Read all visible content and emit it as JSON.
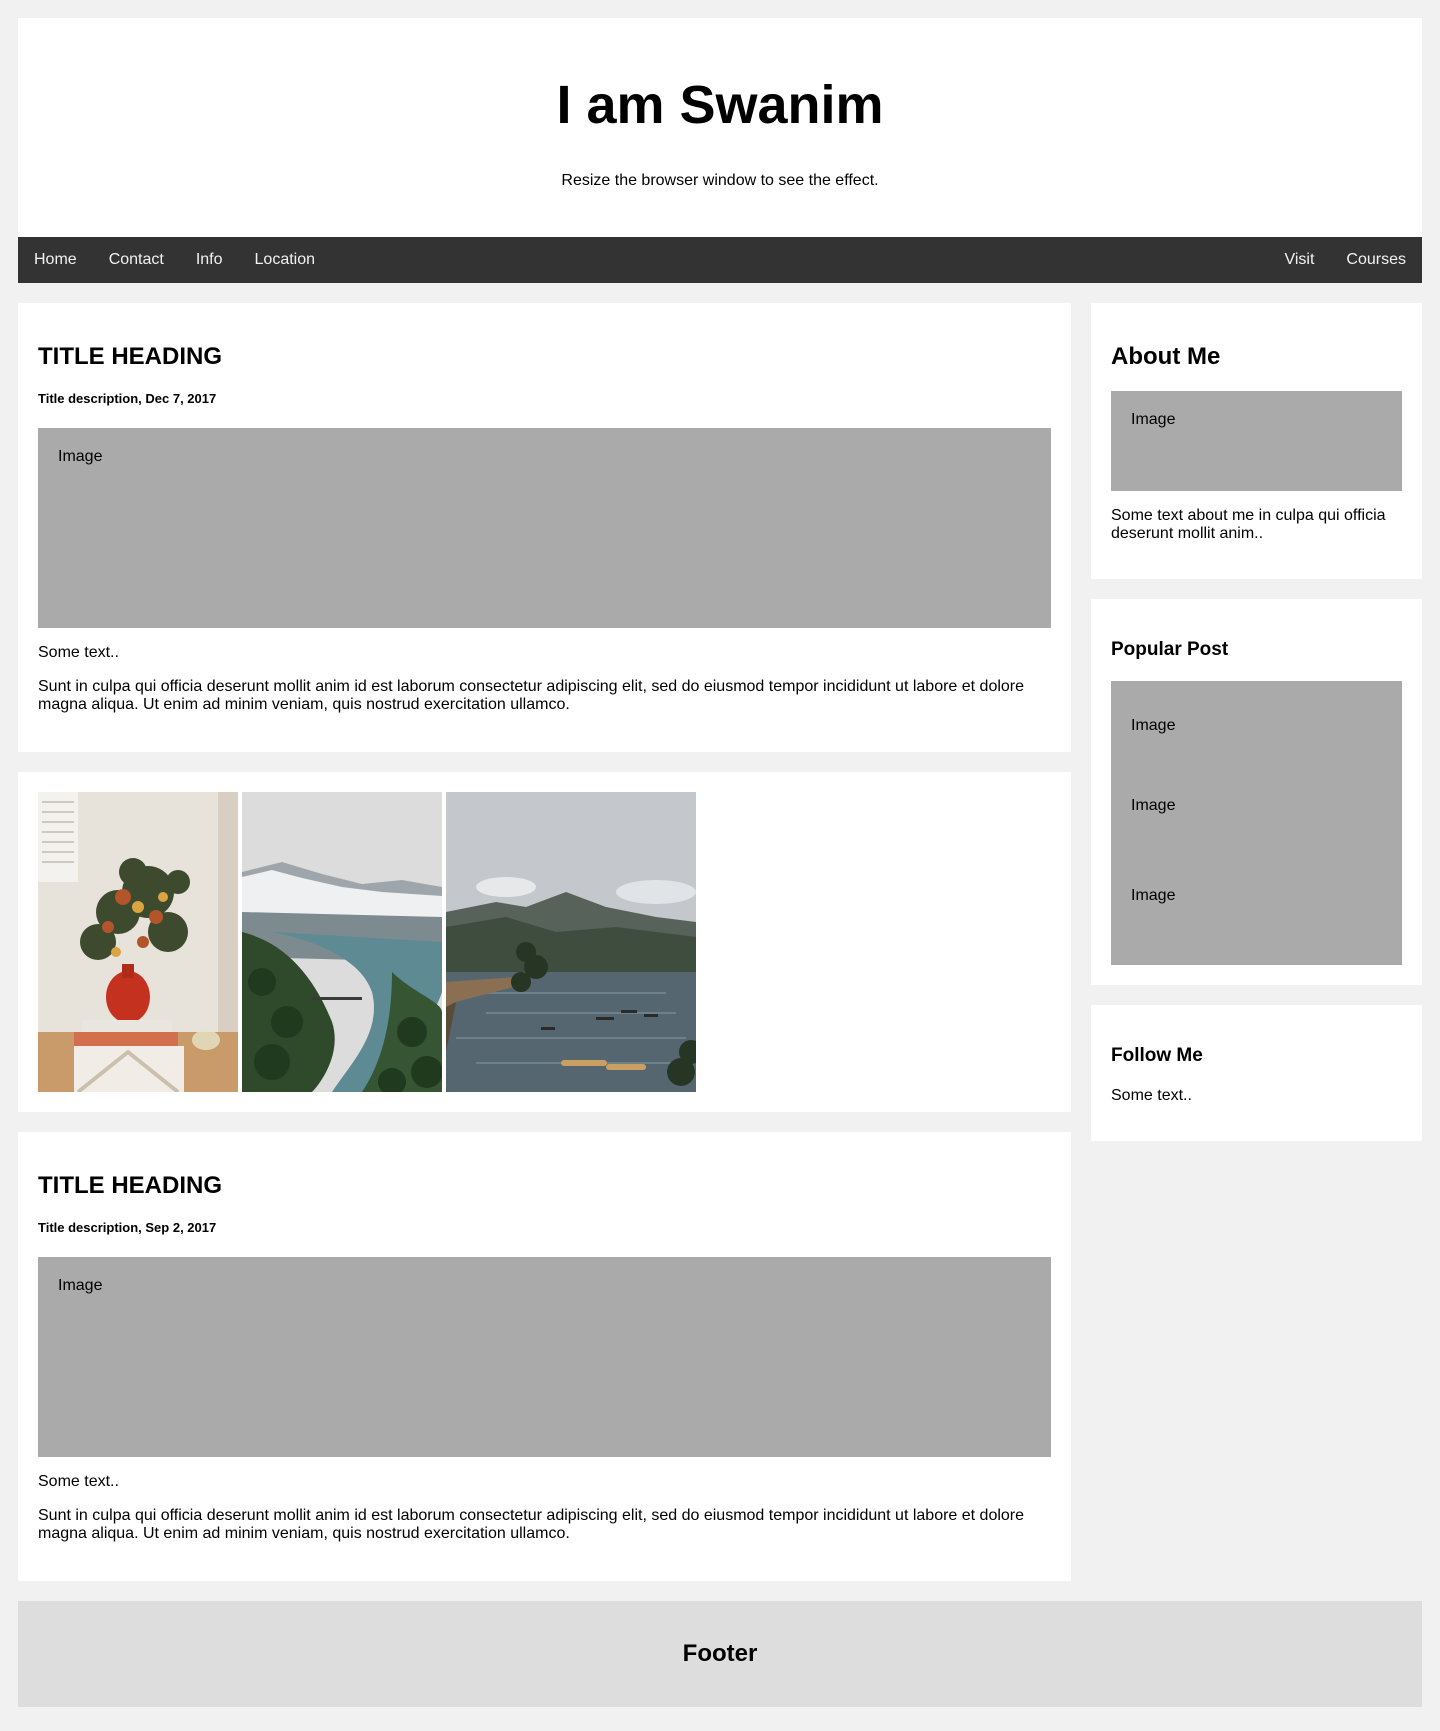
{
  "header": {
    "title": "I am Swanim",
    "subtitle": "Resize the browser window to see the effect."
  },
  "nav": {
    "left": [
      "Home",
      "Contact",
      "Info",
      "Location"
    ],
    "right": [
      "Visit",
      "Courses"
    ]
  },
  "posts": [
    {
      "title": "TITLE HEADING",
      "meta": "Title description, Dec 7, 2017",
      "image_label": "Image",
      "lead": "Some text..",
      "body": "Sunt in culpa qui officia deserunt mollit anim id est laborum consectetur adipiscing elit, sed do eiusmod tempor incididunt ut labore et dolore magna aliqua. Ut enim ad minim veniam, quis nostrud exercitation ullamco."
    },
    {
      "title": "TITLE HEADING",
      "meta": "Title description, Sep 2, 2017",
      "image_label": "Image",
      "lead": "Some text..",
      "body": "Sunt in culpa qui officia deserunt mollit anim id est laborum consectetur adipiscing elit, sed do eiusmod tempor incididunt ut labore et dolore magna aliqua. Ut enim ad minim veniam, quis nostrud exercitation ullamco."
    }
  ],
  "gallery": [
    "flowers-vase-photo",
    "mountain-river-photo",
    "lake-kayaks-photo"
  ],
  "sidebar": {
    "about": {
      "title": "About Me",
      "image_label": "Image",
      "text": "Some text about me in culpa qui officia deserunt mollit anim.."
    },
    "popular": {
      "title": "Popular Post",
      "images": [
        "Image",
        "Image",
        "Image"
      ]
    },
    "follow": {
      "title": "Follow Me",
      "text": "Some text.."
    }
  },
  "footer": {
    "title": "Footer"
  }
}
